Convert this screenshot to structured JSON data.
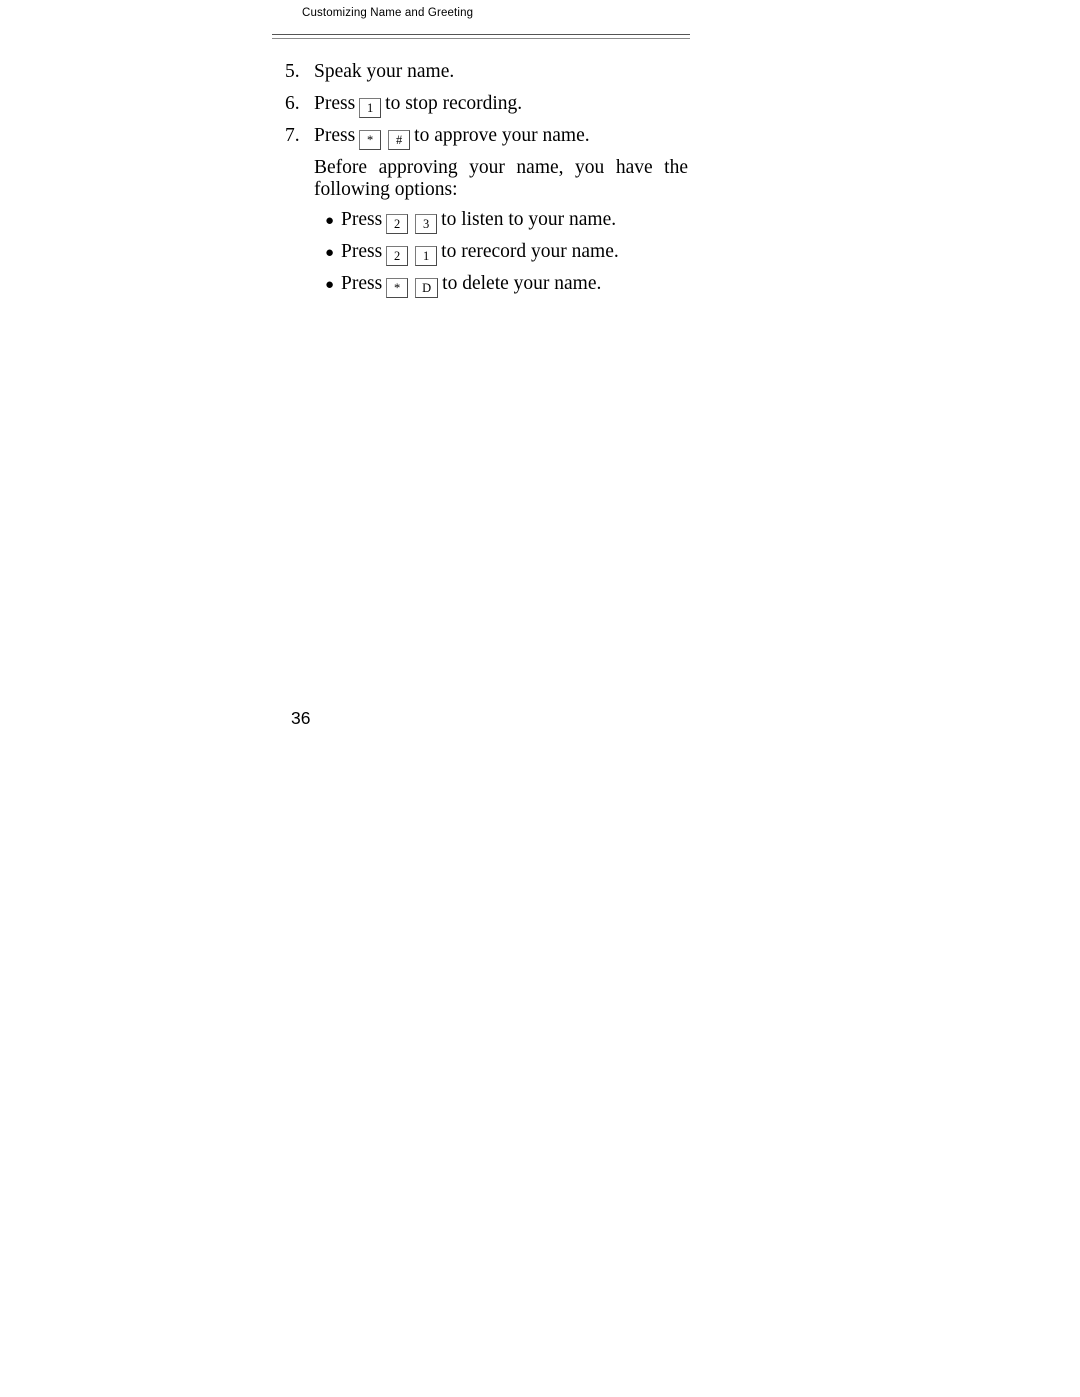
{
  "page": {
    "header_title": "Customizing Name and Greeting",
    "folio": "36",
    "background_color": "#ffffff",
    "text_color": "#000000",
    "rule_color": "#555555"
  },
  "steps": [
    {
      "number": "5.",
      "text": "Speak your name."
    },
    {
      "number": "6.",
      "lead": "Press",
      "keys": [
        "1"
      ],
      "trail": "to stop recording."
    },
    {
      "number": "7.",
      "lead": "Press",
      "keys": [
        "*",
        "#"
      ],
      "trail": "to approve your name."
    }
  ],
  "note": {
    "line1": "Before approving your name, you have the",
    "line2": "following options:"
  },
  "options": [
    {
      "bullet": "●",
      "lead": "Press",
      "keys": [
        "2",
        "3"
      ],
      "trail": "to listen to your name."
    },
    {
      "bullet": "●",
      "lead": "Press",
      "keys": [
        "2",
        "1"
      ],
      "trail": "to rerecord your name."
    },
    {
      "bullet": "●",
      "lead": "Press",
      "keys": [
        "*",
        "D"
      ],
      "trail": "to delete your name."
    }
  ]
}
